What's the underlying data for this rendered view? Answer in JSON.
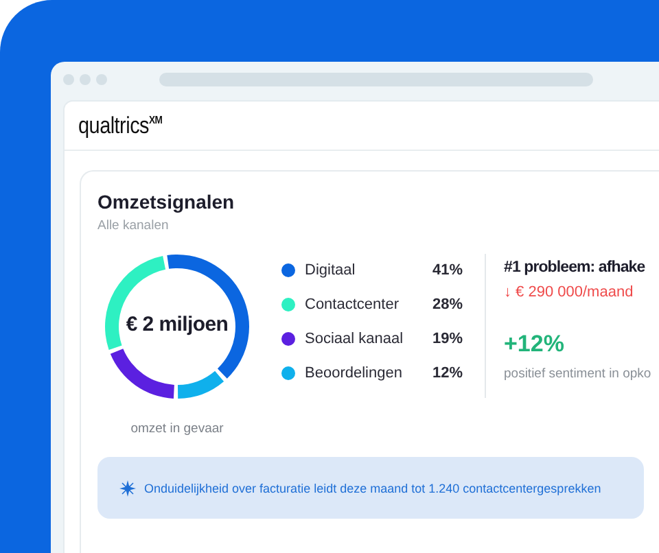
{
  "logo": "qualtrics$^{XM}$",
  "card": {
    "title": "Omzetsignalen",
    "subtitle": "Alle kanalen",
    "donut": {
      "center": "€ 2 miljoen",
      "caption": "omzet in gevaar",
      "chart_data": {
        "type": "donut",
        "categories": [
          "Digitaal",
          "Contactcenter",
          "Sociaal kanaal",
          "Beoordelingen"
        ],
        "values": [
          41,
          28,
          19,
          12
        ]
      }
    },
    "legend": [
      {
        "value": "41%",
        "color": "#0b66e0"
      },
      {
        "value": "28%",
        "color": "#2ef0c2"
      },
      {
        "value": "19%",
        "color": "#5b20e0"
      },
      {
        "value": "12%",
        "color": "#0fb0ec"
      }
    ],
    "insight": {
      "title": "#1 probleem: afhake",
      "loss": "↓ € 290 000/maand",
      "change": "+12%",
      "note": "positief sentiment in opko"
    },
    "banner": "Onduidelijkheid over facturatie leidt deze maand tot 1.240 contactcentergesprekken"
  }
}
